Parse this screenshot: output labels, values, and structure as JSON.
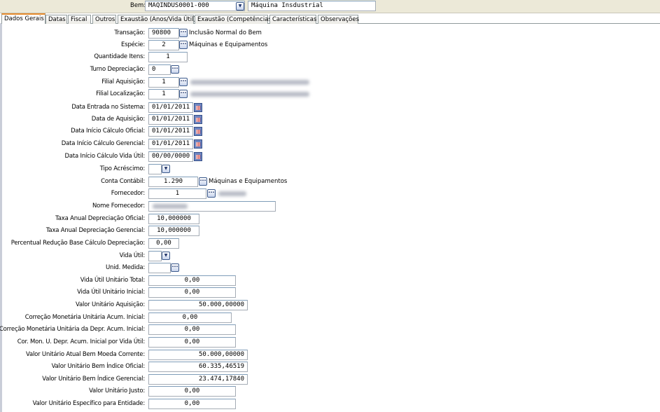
{
  "header": {
    "bem_label": "Bem:",
    "bem_code": "MAQINDUS0001-000",
    "bem_name": "Máquina Insdustrial"
  },
  "tabs": [
    "Dados Gerais",
    "Datas",
    "Fiscal",
    "Outros",
    "Exaustão (Anos/Vida Útil)",
    "Exaustão (Competências)",
    "Características",
    "Observações"
  ],
  "fields": {
    "transacao": {
      "label": "Transação:",
      "value": "90800",
      "desc": "Inclusão Normal do Bem"
    },
    "especie": {
      "label": "Espécie:",
      "value": "2",
      "desc": "Máquinas e Equipamentos"
    },
    "quantidade": {
      "label": "Quantidade Itens:",
      "value": "1"
    },
    "turno": {
      "label": "Turno Depreciação:",
      "value": "0"
    },
    "filial_aquisicao": {
      "label": "Filial Aquisição:",
      "value": "1"
    },
    "filial_localizacao": {
      "label": "Filial Localização:",
      "value": "1"
    },
    "data_entrada": {
      "label": "Data Entrada no Sistema:",
      "value": "01/01/2011"
    },
    "data_aquisicao": {
      "label": "Data de Aquisição:",
      "value": "01/01/2011"
    },
    "data_inicio_oficial": {
      "label": "Data Início Cálculo Oficial:",
      "value": "01/01/2011"
    },
    "data_inicio_gerencial": {
      "label": "Data Início Cálculo Gerencial:",
      "value": "01/01/2011"
    },
    "data_inicio_vida_util": {
      "label": "Data Início Cálculo Vida Útil:",
      "value": "00/00/0000"
    },
    "tipo_acrescimo": {
      "label": "Tipo Acréscimo:",
      "value": ""
    },
    "conta_contabil": {
      "label": "Conta Contábil:",
      "value": "1.290",
      "desc": "Máquinas e Equipamentos"
    },
    "fornecedor": {
      "label": "Fornecedor:",
      "value": "1"
    },
    "nome_fornecedor": {
      "label": "Nome Fornecedor:"
    },
    "taxa_oficial": {
      "label": "Taxa Anual Depreciação Oficial:",
      "value": "10,000000"
    },
    "taxa_gerencial": {
      "label": "Taxa Anual Depreciação Gerencial:",
      "value": "10,000000"
    },
    "percentual_reducao": {
      "label": "Percentual Redução Base Cálculo Depreciação:",
      "value": "0,00"
    },
    "vida_util": {
      "label": "Vida Útil:",
      "value": ""
    },
    "unid_medida": {
      "label": "Unid. Medida:",
      "value": ""
    },
    "vida_util_total": {
      "label": "Vida Útil Unitário Total:",
      "value": "0,00"
    },
    "vida_util_inicial": {
      "label": "Vida Útil Unitário Inicial:",
      "value": "0,00"
    },
    "valor_aquisicao": {
      "label": "Valor Unitário Aquisição:",
      "value": "50.000,00000"
    },
    "correcao_acum": {
      "label": "Correção Monetária Unitária Acum. Inicial:",
      "value": "0,00"
    },
    "correcao_depr": {
      "label": "Correção Monetária Unitária da Depr. Acum. Inicial:",
      "value": "0,00"
    },
    "cor_mon_vida": {
      "label": "Cor. Mon. U. Depr. Acum. Inicial por Vida Útil:",
      "value": "0,00"
    },
    "valor_atual": {
      "label": "Valor Unitário Atual Bem Moeda Corrente:",
      "value": "50.000,00000"
    },
    "valor_indice_oficial": {
      "label": "Valor Unitário Bem Índice Oficial:",
      "value": "60.335,46519"
    },
    "valor_indice_gerencial": {
      "label": "Valor Unitário Bem Índice Gerencial:",
      "value": "23.474,17840"
    },
    "valor_justo": {
      "label": "Valor Unitário Justo:",
      "value": "0,00"
    },
    "valor_especifico": {
      "label": "Valor Unitário Específico para Entidade:",
      "value": "0,00"
    }
  }
}
